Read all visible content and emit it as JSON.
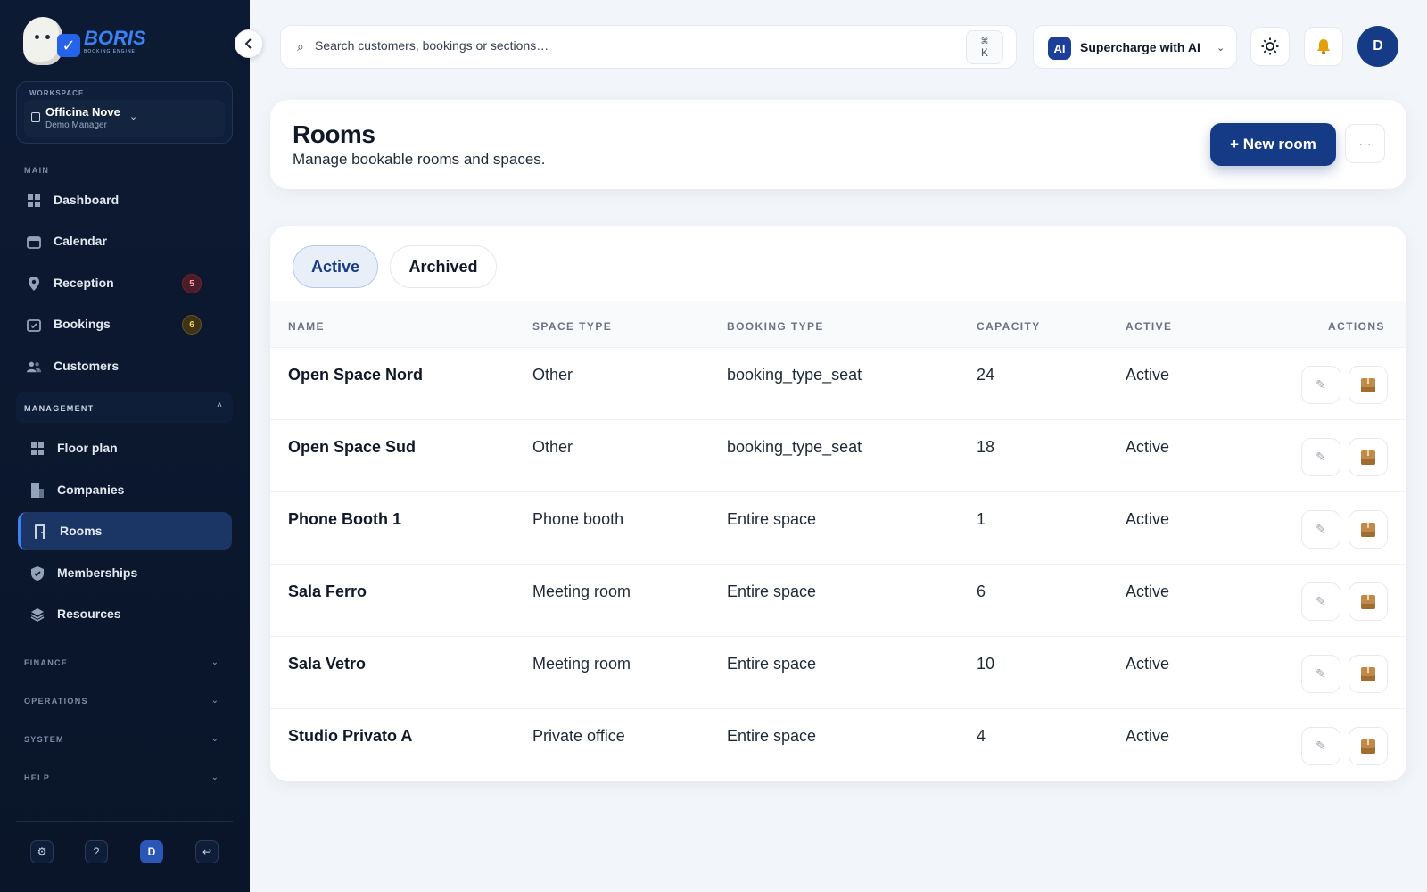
{
  "brand": {
    "name": "BORIS",
    "tagline": "BOOKING ENGINE"
  },
  "workspace": {
    "label": "WORKSPACE",
    "name": "Officina Nove",
    "role": "Demo Manager"
  },
  "sidebar": {
    "main_label": "MAIN",
    "main_items": [
      {
        "label": "Dashboard",
        "icon": "grid-icon"
      },
      {
        "label": "Calendar",
        "icon": "calendar-icon"
      },
      {
        "label": "Reception",
        "icon": "map-pin-icon",
        "badge": "5"
      },
      {
        "label": "Bookings",
        "icon": "calendar-check-icon",
        "badge": "6"
      },
      {
        "label": "Customers",
        "icon": "users-icon"
      }
    ],
    "management_label": "MANAGEMENT",
    "management_items": [
      {
        "label": "Floor plan",
        "icon": "layout-icon"
      },
      {
        "label": "Companies",
        "icon": "building-icon"
      },
      {
        "label": "Rooms",
        "icon": "door-icon",
        "active": true
      },
      {
        "label": "Memberships",
        "icon": "badge-check-icon"
      },
      {
        "label": "Resources",
        "icon": "layers-icon"
      }
    ],
    "groups": [
      "FINANCE",
      "OPERATIONS",
      "SYSTEM",
      "HELP"
    ],
    "footer": {
      "settings": "⚙",
      "help": "?",
      "avatar": "D",
      "logout": "↩"
    }
  },
  "topbar": {
    "search_placeholder": "Search customers, bookings or sections…",
    "shortcut_cmd": "⌘",
    "shortcut_key": "K",
    "ai_badge": "AI",
    "ai_label": "Supercharge with AI",
    "avatar": "D"
  },
  "page": {
    "title": "Rooms",
    "subtitle": "Manage bookable rooms and spaces.",
    "new_button": "+ New room",
    "more_button": "···"
  },
  "tabs": [
    {
      "label": "Active",
      "active": true
    },
    {
      "label": "Archived",
      "active": false
    }
  ],
  "table": {
    "columns": [
      "NAME",
      "SPACE TYPE",
      "BOOKING TYPE",
      "CAPACITY",
      "ACTIVE",
      "ACTIONS"
    ],
    "rows": [
      {
        "name": "Open Space Nord",
        "space_type": "Other",
        "booking_type": "booking_type_seat",
        "capacity": "24",
        "active": "Active"
      },
      {
        "name": "Open Space Sud",
        "space_type": "Other",
        "booking_type": "booking_type_seat",
        "capacity": "18",
        "active": "Active"
      },
      {
        "name": "Phone Booth 1",
        "space_type": "Phone booth",
        "booking_type": "Entire space",
        "capacity": "1",
        "active": "Active"
      },
      {
        "name": "Sala Ferro",
        "space_type": "Meeting room",
        "booking_type": "Entire space",
        "capacity": "6",
        "active": "Active"
      },
      {
        "name": "Sala Vetro",
        "space_type": "Meeting room",
        "booking_type": "Entire space",
        "capacity": "10",
        "active": "Active"
      },
      {
        "name": "Studio Privato A",
        "space_type": "Private office",
        "booking_type": "Entire space",
        "capacity": "4",
        "active": "Active"
      }
    ]
  },
  "colors": {
    "sidebar_bg": "#0c1a33",
    "primary": "#163b86",
    "active_nav": "#1b3564"
  }
}
